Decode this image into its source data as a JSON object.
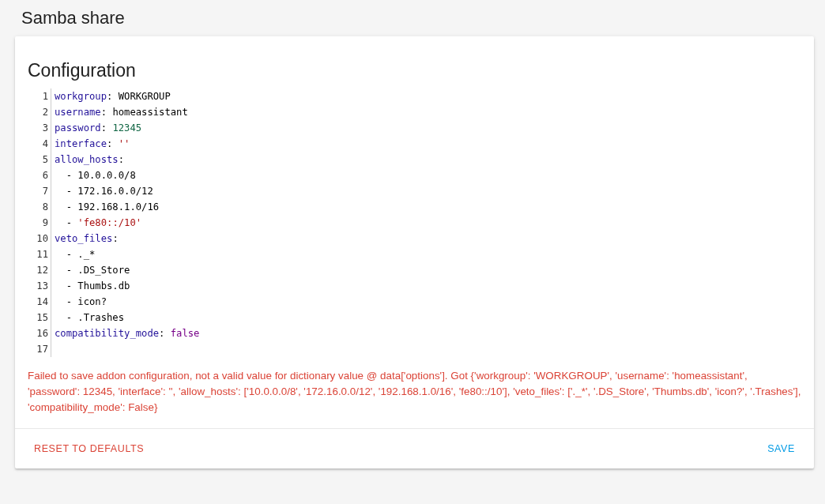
{
  "page_title": "Samba share",
  "card": {
    "heading": "Configuration",
    "editor": {
      "lines": [
        {
          "number": "1",
          "segments": [
            {
              "kind": "key",
              "text": "workgroup"
            },
            {
              "kind": "plain",
              "text": ": WORKGROUP"
            }
          ]
        },
        {
          "number": "2",
          "segments": [
            {
              "kind": "key",
              "text": "username"
            },
            {
              "kind": "plain",
              "text": ": homeassistant"
            }
          ]
        },
        {
          "number": "3",
          "segments": [
            {
              "kind": "key",
              "text": "password"
            },
            {
              "kind": "plain",
              "text": ": "
            },
            {
              "kind": "number",
              "text": "12345"
            }
          ]
        },
        {
          "number": "4",
          "segments": [
            {
              "kind": "key",
              "text": "interface"
            },
            {
              "kind": "plain",
              "text": ": "
            },
            {
              "kind": "string",
              "text": "''"
            }
          ]
        },
        {
          "number": "5",
          "segments": [
            {
              "kind": "key",
              "text": "allow_hosts"
            },
            {
              "kind": "plain",
              "text": ":"
            }
          ]
        },
        {
          "number": "6",
          "segments": [
            {
              "kind": "plain",
              "text": "  - 10.0.0.0/8"
            }
          ]
        },
        {
          "number": "7",
          "segments": [
            {
              "kind": "plain",
              "text": "  - 172.16.0.0/12"
            }
          ]
        },
        {
          "number": "8",
          "segments": [
            {
              "kind": "plain",
              "text": "  - 192.168.1.0/16"
            }
          ]
        },
        {
          "number": "9",
          "segments": [
            {
              "kind": "plain",
              "text": "  - "
            },
            {
              "kind": "string",
              "text": "'fe80::/10'"
            }
          ]
        },
        {
          "number": "10",
          "segments": [
            {
              "kind": "key",
              "text": "veto_files"
            },
            {
              "kind": "plain",
              "text": ":"
            }
          ]
        },
        {
          "number": "11",
          "segments": [
            {
              "kind": "plain",
              "text": "  - ._*"
            }
          ]
        },
        {
          "number": "12",
          "segments": [
            {
              "kind": "plain",
              "text": "  - .DS_Store"
            }
          ]
        },
        {
          "number": "13",
          "segments": [
            {
              "kind": "plain",
              "text": "  - Thumbs.db"
            }
          ]
        },
        {
          "number": "14",
          "segments": [
            {
              "kind": "plain",
              "text": "  - icon?"
            }
          ]
        },
        {
          "number": "15",
          "segments": [
            {
              "kind": "plain",
              "text": "  - .Trashes"
            }
          ]
        },
        {
          "number": "16",
          "segments": [
            {
              "kind": "key",
              "text": "compatibility_mode"
            },
            {
              "kind": "plain",
              "text": ": "
            },
            {
              "kind": "keyword",
              "text": "false"
            }
          ]
        },
        {
          "number": "17"
        }
      ]
    },
    "error": "Failed to save addon configuration, not a valid value for dictionary value @ data['options']. Got {'workgroup': 'WORKGROUP', 'username': 'homeassistant', 'password': 12345, 'interface': '', 'allow_hosts': ['10.0.0.0/8', '172.16.0.0/12', '192.168.1.0/16', 'fe80::/10'], 'veto_files': ['._*', '.DS_Store', 'Thumbs.db', 'icon?', '.Trashes'], 'compatibility_mode': False}",
    "actions": [
      {
        "kind": "danger",
        "label": "RESET TO DEFAULTS"
      },
      {
        "kind": "primary",
        "label": "SAVE"
      }
    ]
  }
}
